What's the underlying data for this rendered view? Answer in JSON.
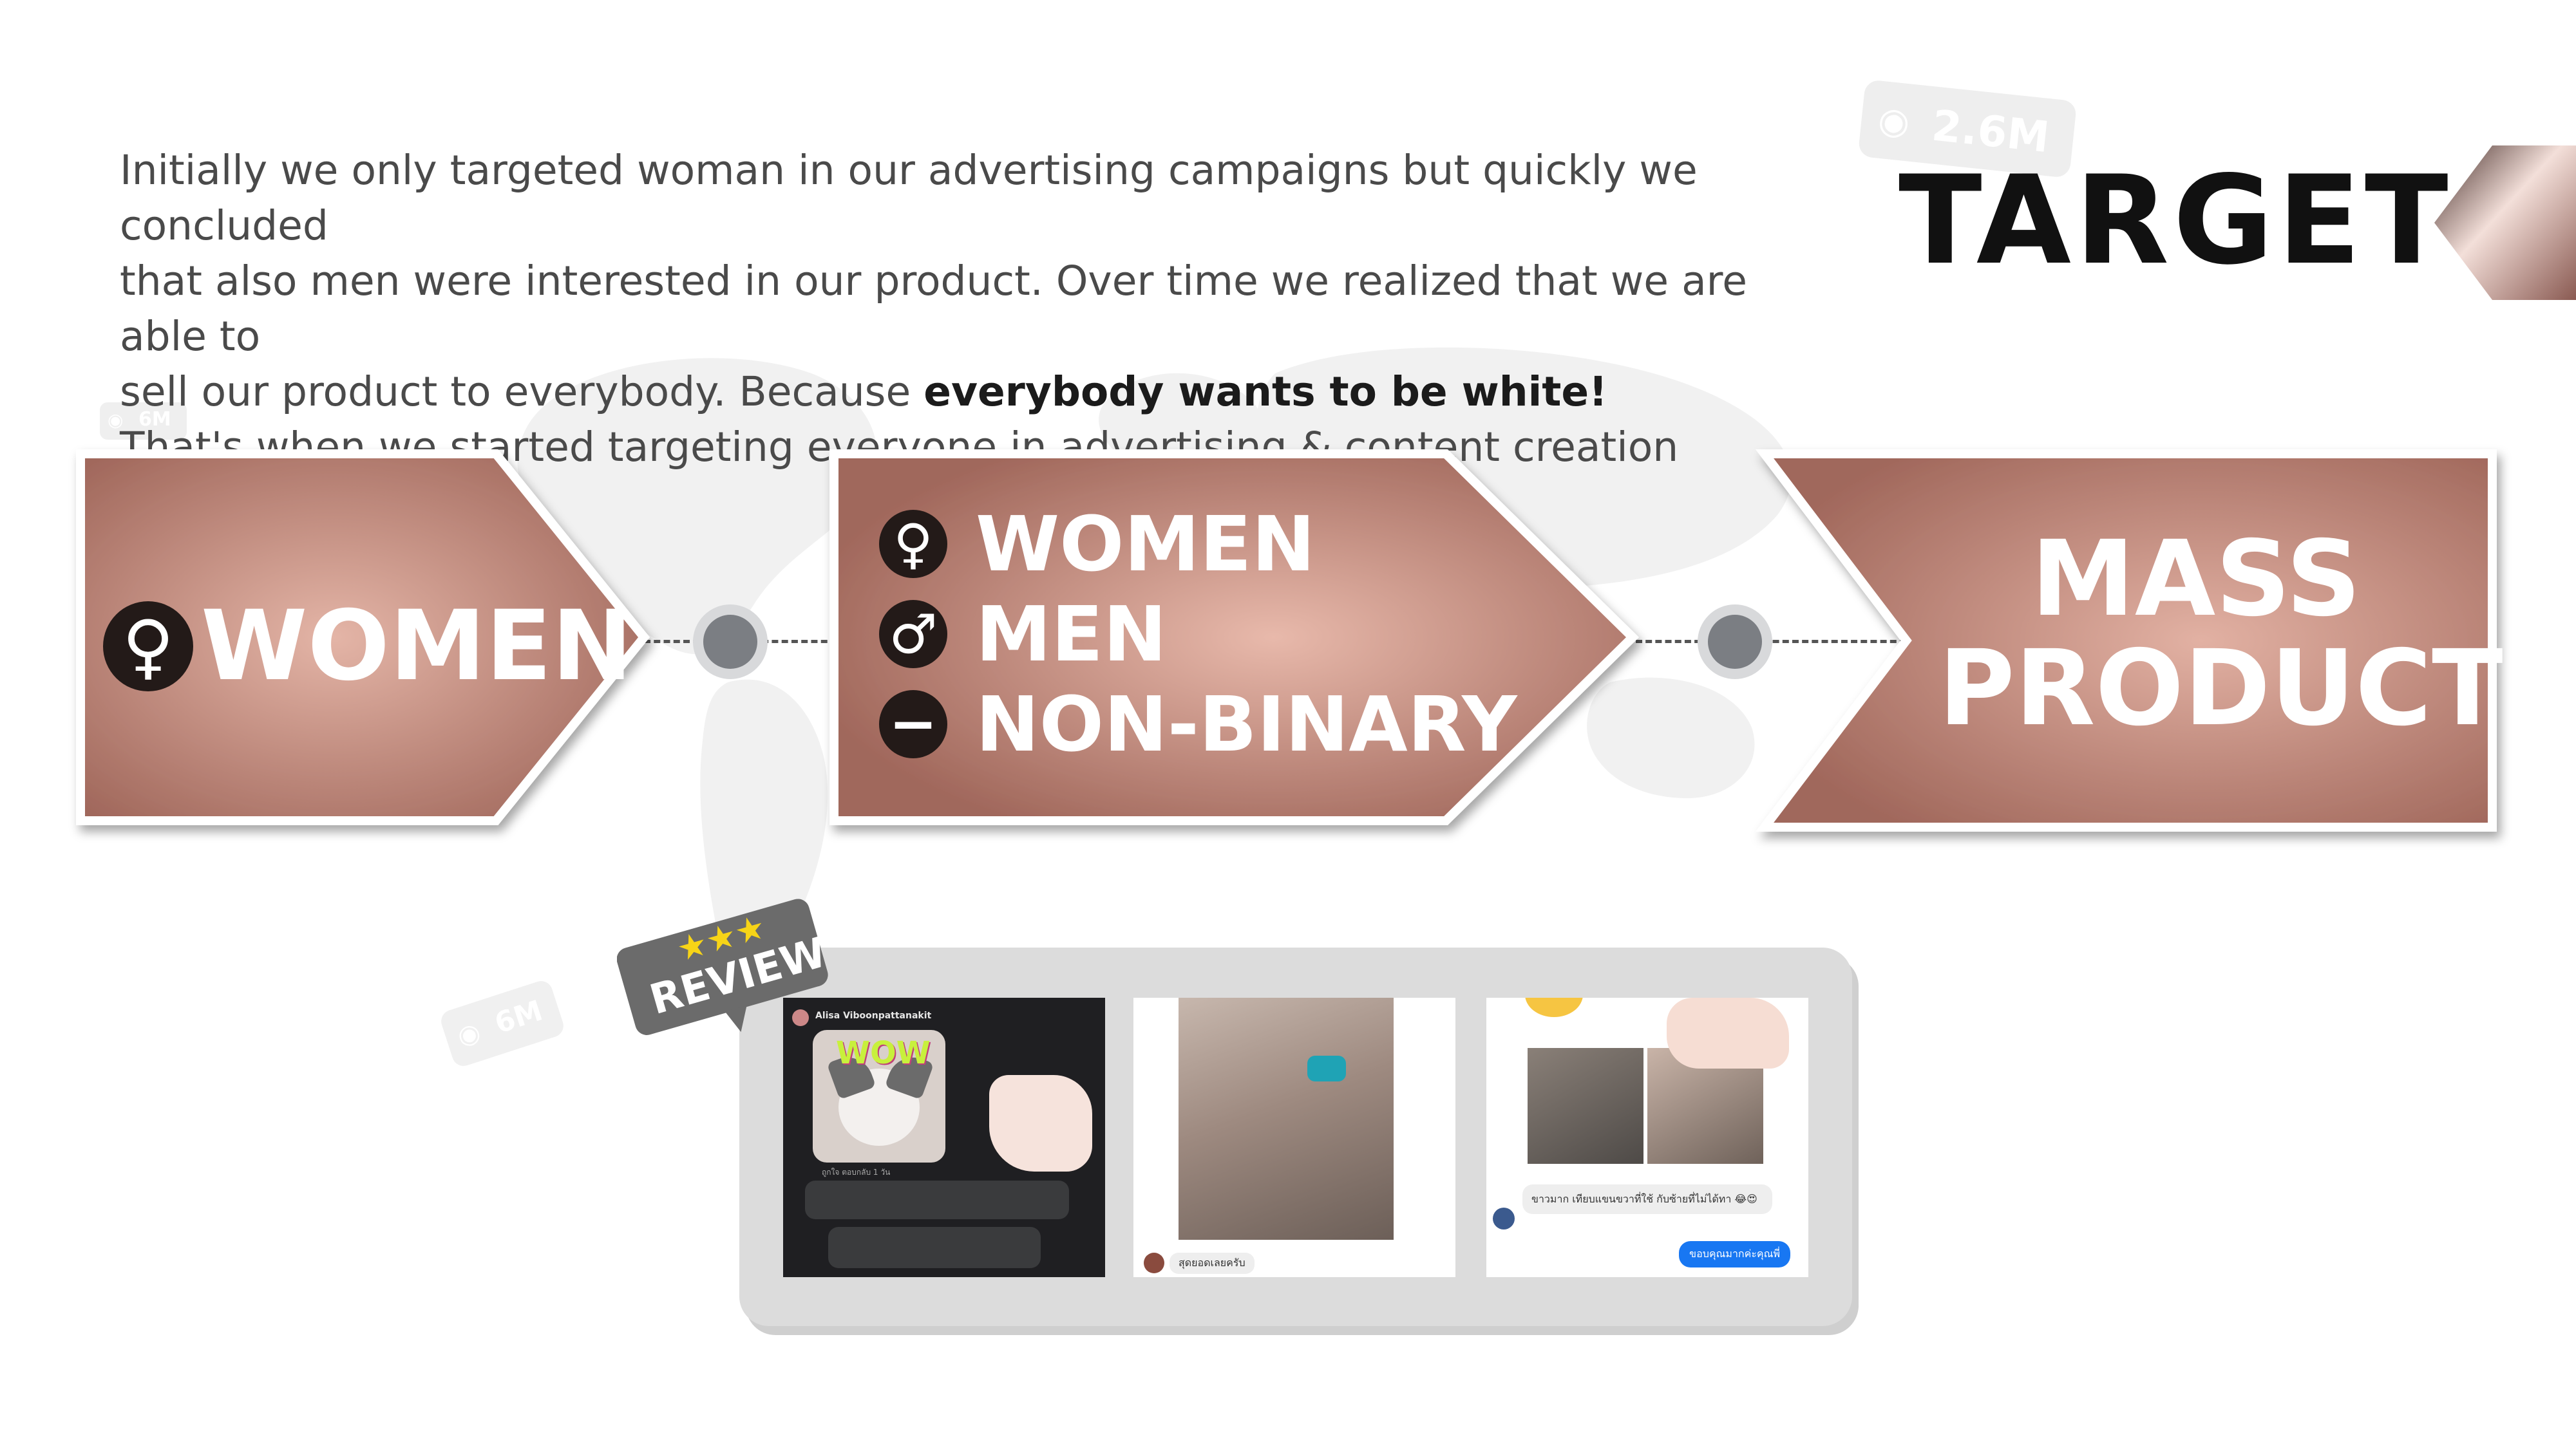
{
  "intro": {
    "line1": "Initially we only targeted woman in our advertising campaigns but quickly we concluded",
    "line2": "that also men were interested in our product. Over time we realized that we are able to",
    "line3_prefix": "sell our product to everybody. Because ",
    "line3_bold": "everybody wants to be white!",
    "line4": "That's when we started targeting everyone in advertising & content creation"
  },
  "title": "TARGET",
  "badges": {
    "large": "2.6M",
    "small": "6M"
  },
  "stages": {
    "stage1": {
      "label": "WOMEN",
      "symbol": "♀"
    },
    "stage2": {
      "items": [
        {
          "label": "WOMEN",
          "symbol": "♀"
        },
        {
          "label": "MEN",
          "symbol": "♂"
        },
        {
          "label": "NON-BINARY",
          "symbol": "−"
        }
      ]
    },
    "stage3": {
      "line1": "MASS",
      "line2": "PRODUCT"
    }
  },
  "review_badge": {
    "stars": "★★★",
    "label": "REVIEW"
  },
  "reviews": [
    {
      "name": "Alisa Viboonpattanakit",
      "sticker": "WOW",
      "meta": "ถูกใจ  ตอบกลับ  1 วัน"
    },
    {
      "caption": "สุดยอดเลยครับ"
    },
    {
      "caption": "ขาวมาก เทียบแขนขวาที่ใช้ กับซ้ายที่ไม่ได้ทา 😂😍",
      "reply": "ขอบคุณมากค่ะคุณพี่"
    }
  ],
  "colors": {
    "arrow_light": "#dcaa9b",
    "arrow_dark": "#a0675b",
    "dark": "#231a18"
  }
}
